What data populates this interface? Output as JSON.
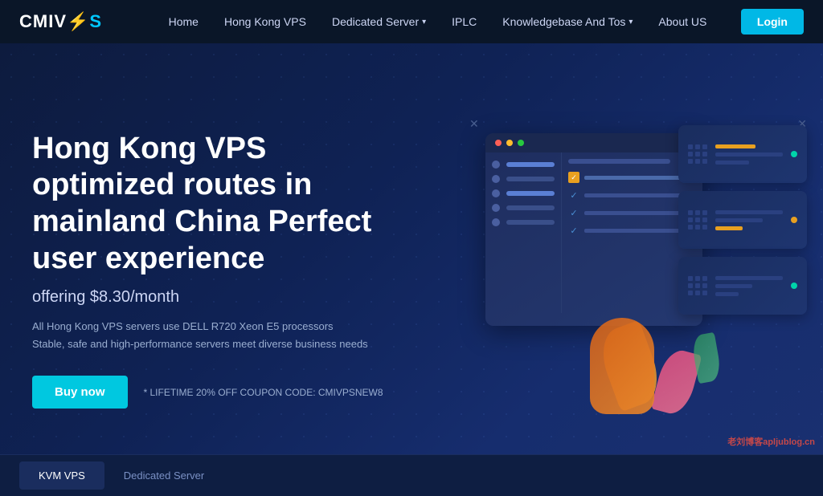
{
  "logo": {
    "text_part1": "CMIV",
    "text_part2": "PS"
  },
  "navbar": {
    "items": [
      {
        "label": "Home",
        "has_dropdown": false
      },
      {
        "label": "Hong Kong VPS",
        "has_dropdown": false
      },
      {
        "label": "Dedicated Server",
        "has_dropdown": true
      },
      {
        "label": "IPLC",
        "has_dropdown": false
      },
      {
        "label": "Knowledgebase And Tos",
        "has_dropdown": true
      },
      {
        "label": "About US",
        "has_dropdown": false
      }
    ],
    "login_label": "Login"
  },
  "hero": {
    "title": "Hong Kong VPS optimized routes in mainland China Perfect user experience",
    "price": "offering $8.30/month",
    "desc_line1": "All Hong Kong VPS servers use DELL R720 Xeon E5 processors",
    "desc_line2": "Stable, safe and high-performance servers meet diverse business needs",
    "buy_btn": "Buy now",
    "coupon": "* LIFETIME 20% OFF COUPON CODE: CMIVPSNEW8"
  },
  "tabs": [
    {
      "label": "KVM VPS",
      "active": true
    },
    {
      "label": "Dedicated Server",
      "active": false
    }
  ],
  "watermark": "老刘博客apljublog.cn"
}
